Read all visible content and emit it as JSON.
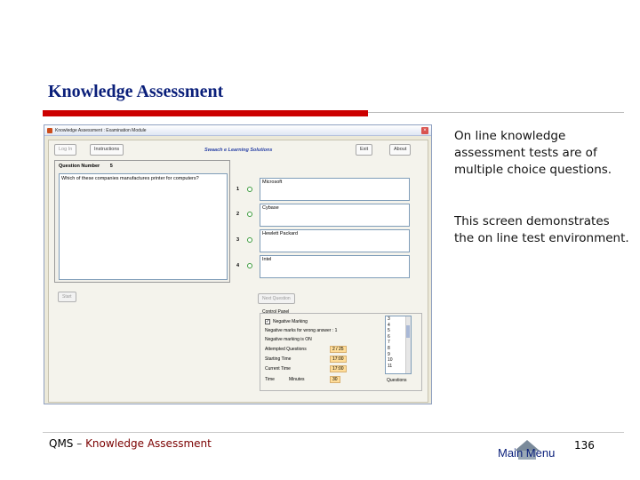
{
  "slide": {
    "title": "Knowledge Assessment"
  },
  "window": {
    "title": "Knowledge Assessment : Examination Module",
    "close_glyph": "×"
  },
  "app": {
    "tabs": {
      "login": "Log In",
      "instructions": "Instructions",
      "exit": "Exit",
      "about": "About"
    },
    "brand": "Swaach e Learning Solutions",
    "question": {
      "number_label": "Question Number",
      "number_value": "5",
      "text": "Which of these companies manufactures printer for computers?"
    },
    "options": [
      {
        "num": "1",
        "text": "Microsoft"
      },
      {
        "num": "2",
        "text": "Cybase"
      },
      {
        "num": "3",
        "text": "Hewlett Packard"
      },
      {
        "num": "4",
        "text": "Intel"
      }
    ],
    "buttons": {
      "start": "Start",
      "next": "Next Question"
    },
    "control_panel": {
      "legend": "Control Panel",
      "negative_marking": "Negative Marking",
      "negative_marks_line": "Negative marks for wrong answer : 1",
      "negative_status": "Negative marking is ON",
      "attempted_label": "Attempted Questions",
      "attempted_value": "2 / 25",
      "starting_label": "Starting Time",
      "starting_value": "17:00",
      "current_label": "Current Time",
      "current_value": "17:00",
      "time_label": "Time",
      "minutes_label": "Minutes",
      "minutes_value": "30",
      "question_list": [
        "3",
        "4",
        "5",
        "6",
        "7",
        "8",
        "9",
        "10",
        "11"
      ],
      "questions_caption": "Questions"
    }
  },
  "description": {
    "para1": "On line knowledge assessment tests are of multiple choice questions.",
    "para2": "This screen demonstrates the on line test environment."
  },
  "footer": {
    "left_prefix": "QMS",
    "left_dash": " – ",
    "left_sub": "Knowledge Assessment",
    "main_menu": "Main Menu",
    "page_number": "136"
  }
}
